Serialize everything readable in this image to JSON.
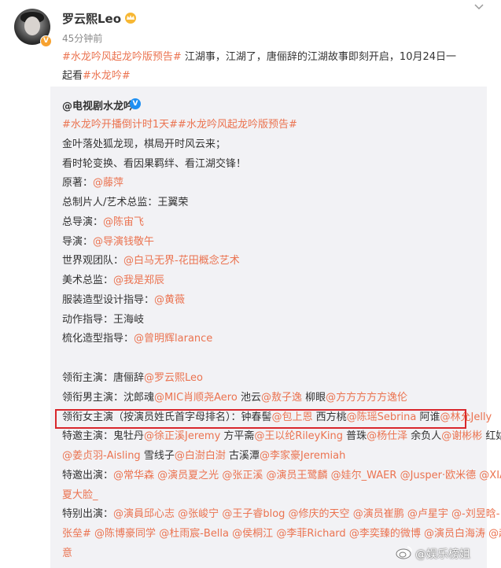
{
  "post": {
    "username": "罗云熙Leo",
    "time": "45分钟前",
    "text_l1": [
      {
        "t": "#水龙吟风起龙吟版预告#",
        "link": true
      },
      {
        "t": " 江湖事，江湖了，唐俪辞的江湖故事即刻开启，10月24日一",
        "link": false
      }
    ],
    "text_l2": [
      {
        "t": "起看",
        "link": false
      },
      {
        "t": "#水龙吟#",
        "link": true
      }
    ]
  },
  "repost": {
    "username": "@电视剧水龙吟",
    "lines": [
      [
        {
          "t": "#水龙吟开播倒计时1天##水龙吟风起龙吟版预告#",
          "link": true
        }
      ],
      [
        {
          "t": "金叶落处狐龙现，棋局开时风云来；",
          "link": false
        }
      ],
      [
        {
          "t": "看时轮变换、看因果羁绊、看江湖交锋！",
          "link": false
        }
      ],
      [
        {
          "t": "原著：",
          "link": false
        },
        {
          "t": "@藤萍",
          "link": true
        }
      ],
      [
        {
          "t": "总制片人/艺术总监：王翼荣",
          "link": false
        }
      ],
      [
        {
          "t": "总导演：",
          "link": false
        },
        {
          "t": "@陈宙飞",
          "link": true
        }
      ],
      [
        {
          "t": "导演：",
          "link": false
        },
        {
          "t": "@导演钱敬午",
          "link": true
        }
      ],
      [
        {
          "t": "世界观团队：",
          "link": false
        },
        {
          "t": "@白马无界-花田概念艺术",
          "link": true
        }
      ],
      [
        {
          "t": "美术总监：",
          "link": false
        },
        {
          "t": "@我是郑辰",
          "link": true
        }
      ],
      [
        {
          "t": "服装造型设计指导：",
          "link": false
        },
        {
          "t": "@黄薇",
          "link": true
        }
      ],
      [
        {
          "t": "动作指导：王海岐",
          "link": false
        }
      ],
      [
        {
          "t": "梳化造型指导：",
          "link": false
        },
        {
          "t": "@曾明辉larance",
          "link": true
        }
      ],
      [],
      [
        {
          "t": "领衔主演：唐俪辞",
          "link": false
        },
        {
          "t": "@罗云熙Leo",
          "link": true
        }
      ],
      [
        {
          "t": "领衔男主演：沈郎魂",
          "link": false
        },
        {
          "t": "@MIC肖顺尧Aero",
          "link": true
        },
        {
          "t": " 池云",
          "link": false
        },
        {
          "t": "@敖子逸",
          "link": true
        },
        {
          "t": " 柳眼",
          "link": false
        },
        {
          "t": "@方方方方方逸伦",
          "link": true
        }
      ],
      [
        {
          "t": "领衔女主演（按演员姓氏首字母排名）：钟春髻",
          "link": false
        },
        {
          "t": "@包上恩",
          "link": true
        },
        {
          "t": " 西方桃",
          "link": false
        },
        {
          "t": "@陈瑶Sebrina",
          "link": true
        },
        {
          "t": " 阿谁",
          "link": false
        },
        {
          "t": "@林允Jelly",
          "link": true
        }
      ],
      [
        {
          "t": "特邀主演：鬼牡丹",
          "link": false
        },
        {
          "t": "@徐正溪Jeremy",
          "link": true
        },
        {
          "t": " 方平斋",
          "link": false
        },
        {
          "t": "@王以纶RileyKing",
          "link": true
        },
        {
          "t": " 普珠",
          "link": false
        },
        {
          "t": "@杨仕泽",
          "link": true
        },
        {
          "t": " 余负人",
          "link": false
        },
        {
          "t": "@谢彬彬",
          "link": true
        },
        {
          "t": " 红姑娘",
          "link": false
        }
      ],
      [
        {
          "t": "@姜贞羽-Aisling",
          "link": true
        },
        {
          "t": " 雪线子",
          "link": false
        },
        {
          "t": "@白澍白澍",
          "link": true
        },
        {
          "t": " 古溪潭",
          "link": false
        },
        {
          "t": "@李家豪Jeremiah",
          "link": true
        }
      ],
      [
        {
          "t": "特邀出演：",
          "link": false
        },
        {
          "t": "@常华森",
          "link": true
        },
        {
          "t": " ",
          "link": false
        },
        {
          "t": "@演员夏之光",
          "link": true
        },
        {
          "t": " ",
          "link": false
        },
        {
          "t": "@张正溪",
          "link": true
        },
        {
          "t": " ",
          "link": false
        },
        {
          "t": "@演员王鹭麟",
          "link": true
        },
        {
          "t": " ",
          "link": false
        },
        {
          "t": "@娃尔_WAER",
          "link": true
        },
        {
          "t": " ",
          "link": false
        },
        {
          "t": "@Jusper·欧米德",
          "link": true
        },
        {
          "t": " ",
          "link": false
        },
        {
          "t": "@XIA",
          "link": true
        }
      ],
      [
        {
          "t": "夏大脸_",
          "link": true
        }
      ],
      [
        {
          "t": "特别出演：",
          "link": false
        },
        {
          "t": "@演員邱心志",
          "link": true
        },
        {
          "t": " ",
          "link": false
        },
        {
          "t": "@张峻宁",
          "link": true
        },
        {
          "t": " ",
          "link": false
        },
        {
          "t": "@王子睿blog",
          "link": true
        },
        {
          "t": " ",
          "link": false
        },
        {
          "t": "@修庆的天空",
          "link": true
        },
        {
          "t": " ",
          "link": false
        },
        {
          "t": "@演员崔鹏",
          "link": true
        },
        {
          "t": " ",
          "link": false
        },
        {
          "t": "@卢星宇",
          "link": true
        },
        {
          "t": " ",
          "link": false
        },
        {
          "t": "@-刘昱晗- #",
          "link": true
        }
      ],
      [
        {
          "t": "张垒#",
          "link": true
        },
        {
          "t": " ",
          "link": false
        },
        {
          "t": "@陈博豪同学",
          "link": true
        },
        {
          "t": " ",
          "link": false
        },
        {
          "t": "@杜雨宸-Bella",
          "link": true
        },
        {
          "t": " ",
          "link": false
        },
        {
          "t": "@侯桐江",
          "link": true
        },
        {
          "t": " ",
          "link": false
        },
        {
          "t": "@李菲Richard",
          "link": true
        },
        {
          "t": " ",
          "link": false
        },
        {
          "t": "@李奕臻的微博",
          "link": true
        },
        {
          "t": " ",
          "link": false
        },
        {
          "t": "@演员白海涛",
          "link": true
        },
        {
          "t": " ",
          "link": false
        },
        {
          "t": "@赵诗",
          "link": true
        }
      ],
      [
        {
          "t": "意",
          "link": true
        }
      ]
    ]
  },
  "watermark": "@娱乐榜姐",
  "colors": {
    "link": "#eb7350",
    "text": "#333333",
    "muted": "#8a8a8a",
    "repost_bg": "#f2f2f5",
    "highlight": "#d9272c"
  }
}
